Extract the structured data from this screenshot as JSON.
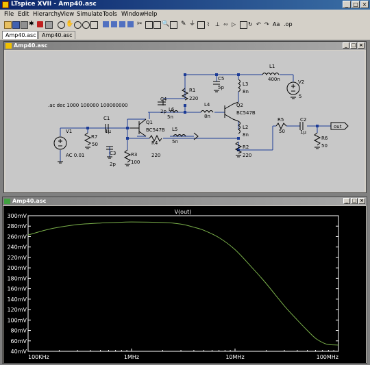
{
  "app": {
    "title": "LTspice XVII - Amp40.asc"
  },
  "menu": [
    "File",
    "Edit",
    "Hierarchy",
    "View",
    "Simulate",
    "Tools",
    "Window",
    "Help"
  ],
  "tabs": [
    {
      "label": "Amp40.asc"
    },
    {
      "label": "Amp40.asc"
    }
  ],
  "schematic_window": {
    "title": "Amp40.asc"
  },
  "schematic": {
    "directive": ".ac dec 1000 100000 100000000",
    "labels": {
      "L1": "L1",
      "L1_val": "400n",
      "V2": "V2",
      "V2_val": "5",
      "C5": "C5",
      "C5_val": "5p",
      "L3": "L3",
      "L3_val": "8n",
      "R1": "R1",
      "R1_val": "220",
      "C4": "C4",
      "C4_val": "2p",
      "L6": "L6",
      "L6_val": "5n",
      "L4": "L4",
      "L4_val": "8n",
      "Q2": "Q2",
      "Q2_model": "BC547B",
      "Q1": "Q1",
      "Q1_model": "BC547B",
      "V1": "V1",
      "V1_val": "AC 0.01",
      "C1": "C1",
      "C1_val": "1µ",
      "R7": "R7",
      "R7_val": "50",
      "L5": "L5",
      "L5_val": "5n",
      "C3": "C3",
      "C3_val": "2p",
      "R3": "R3",
      "R3_val": "100",
      "R4": "R4",
      "R4_val": "220",
      "L2": "L2",
      "L2_val": "8n",
      "R2": "R2",
      "R2_val": "220",
      "R5": "R5",
      "R5_val": "50",
      "C2": "C2",
      "C2_val": "1µ",
      "R6": "R6",
      "R6_val": "50",
      "out": "out"
    }
  },
  "plot_window": {
    "title": "Amp40.asc"
  },
  "chart_data": {
    "type": "line",
    "title": "V(out)",
    "x_scale": "log",
    "xlim": [
      100000,
      100000000
    ],
    "ylim": [
      40,
      300
    ],
    "x_ticks": [
      {
        "v": 100000,
        "label": "100KHz"
      },
      {
        "v": 1000000,
        "label": "1MHz"
      },
      {
        "v": 10000000,
        "label": "10MHz"
      },
      {
        "v": 100000000,
        "label": "100MHz"
      }
    ],
    "y_ticks": [
      300,
      280,
      260,
      240,
      220,
      200,
      180,
      160,
      140,
      120,
      100,
      80,
      60,
      40
    ],
    "y_tick_labels": [
      "300mV",
      "280mV",
      "260mV",
      "240mV",
      "220mV",
      "200mV",
      "180mV",
      "160mV",
      "140mV",
      "120mV",
      "100mV",
      "80mV",
      "60mV",
      "40mV"
    ],
    "grid": false,
    "series": [
      {
        "name": "V(out)",
        "color": "#7ab04a",
        "x": [
          100000,
          150000,
          200000,
          300000,
          500000,
          700000,
          1000000,
          2000000,
          3000000,
          4000000,
          5000000,
          7000000,
          10000000,
          15000000,
          20000000,
          30000000,
          40000000,
          50000000,
          60000000,
          70000000,
          80000000,
          100000000
        ],
        "y": [
          263,
          273,
          278,
          283,
          286,
          287,
          288,
          287,
          284,
          278,
          272,
          258,
          235,
          198,
          170,
          127,
          100,
          80,
          65,
          57,
          53,
          52
        ]
      }
    ]
  },
  "colors": {
    "plot_bg": "#000000",
    "trace": "#7ab04a",
    "title_trace": "#7ab04a",
    "wire": "#1c3b96",
    "component": "#000000",
    "schematic_bg": "#c8c8c8"
  }
}
